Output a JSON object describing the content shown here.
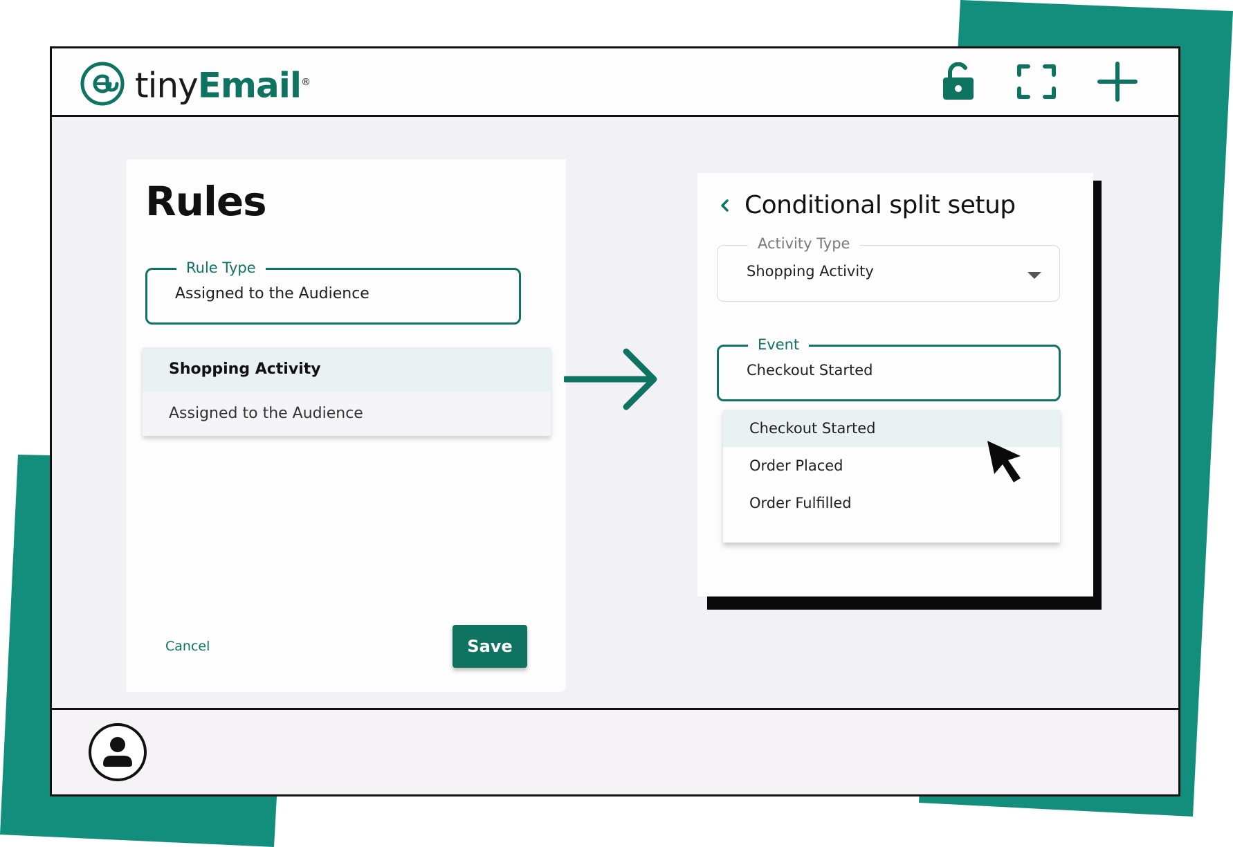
{
  "app": {
    "brand_tiny": "tiny",
    "brand_email": "Email",
    "brand_reg": "®",
    "accent_color": "#0f7361"
  },
  "toolbar": {
    "icons": [
      "unlock-icon",
      "fullscreen-icon",
      "plus-icon"
    ]
  },
  "rules": {
    "title": "Rules",
    "rule_type": {
      "label": "Rule Type",
      "value": "Assigned to the Audience"
    },
    "options": [
      {
        "label": "Shopping Activity",
        "selected": true
      },
      {
        "label": "Assigned to the Audience",
        "selected": false
      }
    ],
    "cancel_label": "Cancel",
    "save_label": "Save"
  },
  "split": {
    "title": "Conditional split setup",
    "activity_type": {
      "label": "Activity Type",
      "value": "Shopping Activity"
    },
    "event": {
      "label": "Event",
      "value": "Checkout Started"
    },
    "event_options": [
      {
        "label": "Checkout Started",
        "highlighted": true
      },
      {
        "label": "Order Placed",
        "highlighted": false
      },
      {
        "label": "Order Fulfilled",
        "highlighted": false
      }
    ]
  },
  "footer": {
    "avatar_icon": "user-avatar-icon"
  }
}
